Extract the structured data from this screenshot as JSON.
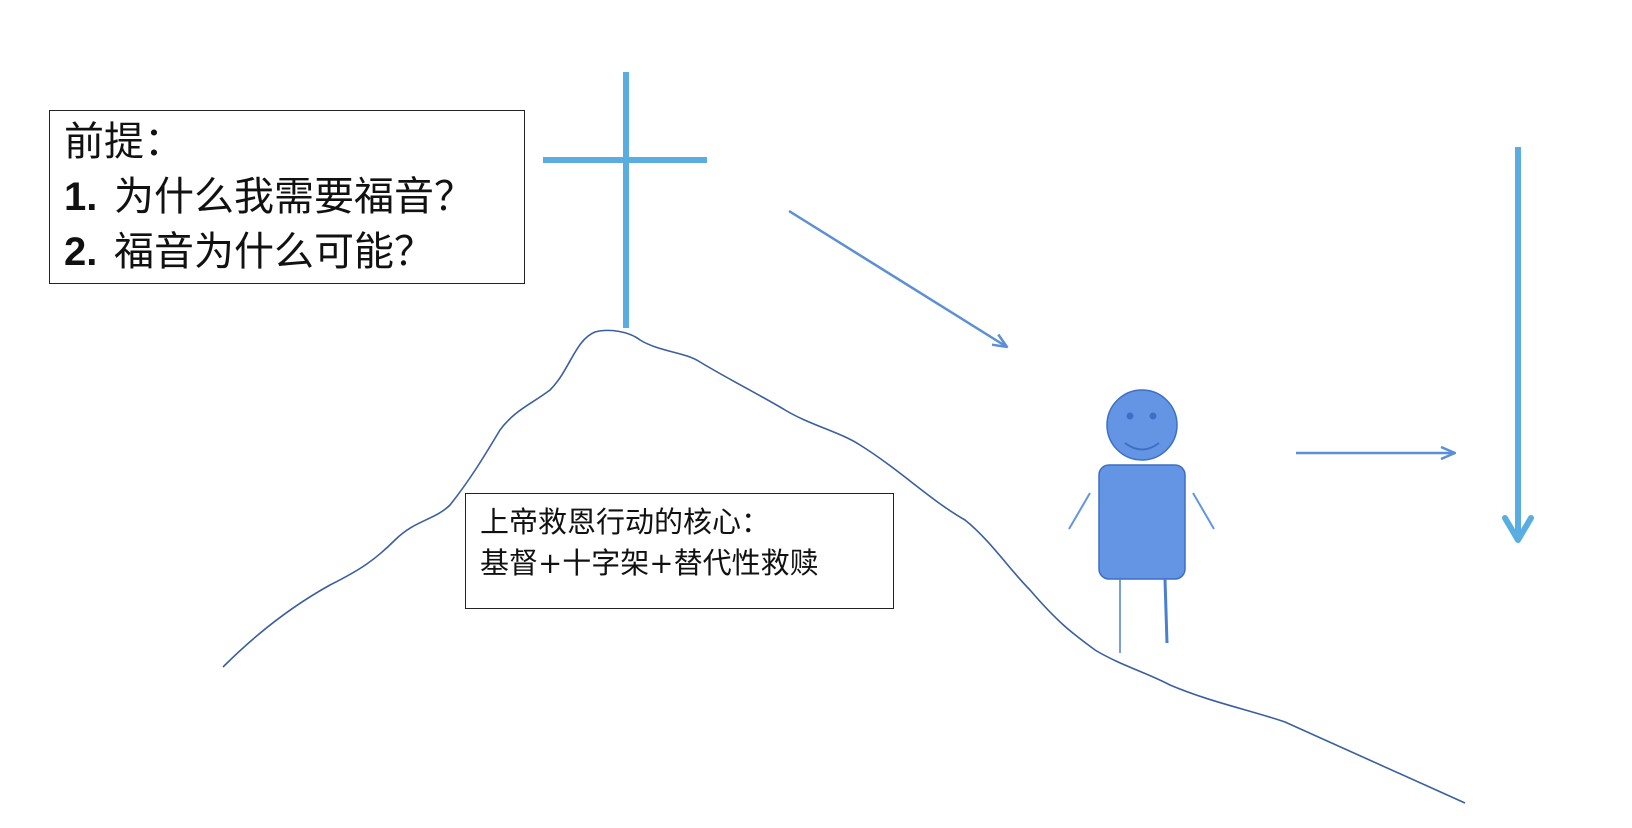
{
  "premise": {
    "title": "前提：",
    "items": [
      {
        "number": "1.",
        "text": "为什么我需要福音？"
      },
      {
        "number": "2.",
        "text": "福音为什么可能？"
      }
    ]
  },
  "core": {
    "line1": "上帝救恩行动的核心：",
    "line2": "基督+十字架+替代性救赎"
  },
  "colors": {
    "cross": "#5aade0",
    "mountain": "#3a5fa0",
    "arrow": "#5b8fd6",
    "vertical_arrow": "#5aade0",
    "figure_fill": "#6495e5",
    "figure_stroke": "#3d6fc4",
    "text": "#111111"
  },
  "icons": {
    "cross": "cross-icon",
    "figure": "smiling-person-icon"
  }
}
